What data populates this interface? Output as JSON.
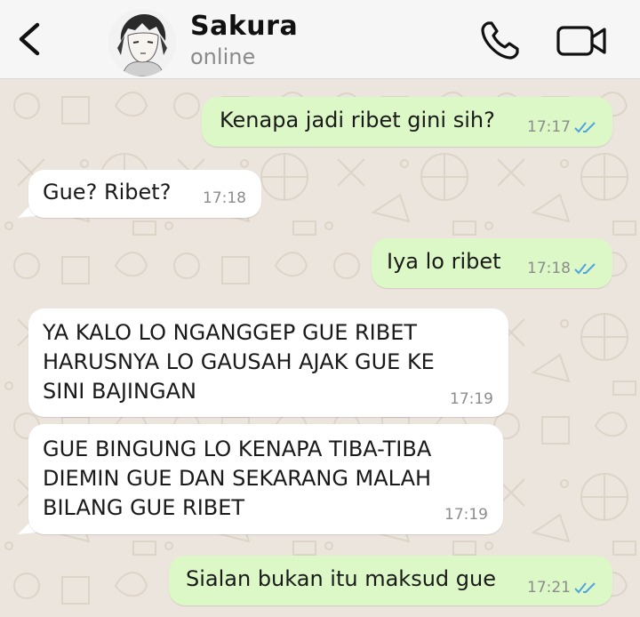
{
  "header": {
    "contact_name": "Sakura",
    "status": "online",
    "back_icon": "chevron-left-icon",
    "call_icon": "phone-icon",
    "video_icon": "video-camera-icon"
  },
  "colors": {
    "outgoing_bubble": "#dcf8c6",
    "incoming_bubble": "#ffffff",
    "chat_background": "#ece5dd",
    "read_ticks": "#4fa3e0",
    "header_background": "#f6f6f6"
  },
  "messages": [
    {
      "direction": "out",
      "text": "Kenapa jadi ribet gini sih?",
      "time": "17:17",
      "status": "read"
    },
    {
      "direction": "in",
      "text": "Gue? Ribet?",
      "time": "17:18"
    },
    {
      "direction": "out",
      "text": "Iya lo ribet",
      "time": "17:18",
      "status": "read"
    },
    {
      "direction": "in",
      "text": "YA KALO LO NGANGGEP GUE RIBET\nHARUSNYA LO GAUSAH AJAK GUE KE\nSINI BAJINGAN",
      "time": "17:19"
    },
    {
      "direction": "in",
      "text": "GUE BINGUNG LO KENAPA TIBA-TIBA\nDIEMIN GUE DAN SEKARANG MALAH\nBILANG GUE RIBET",
      "time": "17:19"
    },
    {
      "direction": "out",
      "text": "Sialan bukan itu maksud gue",
      "time": "17:21",
      "status": "read"
    }
  ]
}
